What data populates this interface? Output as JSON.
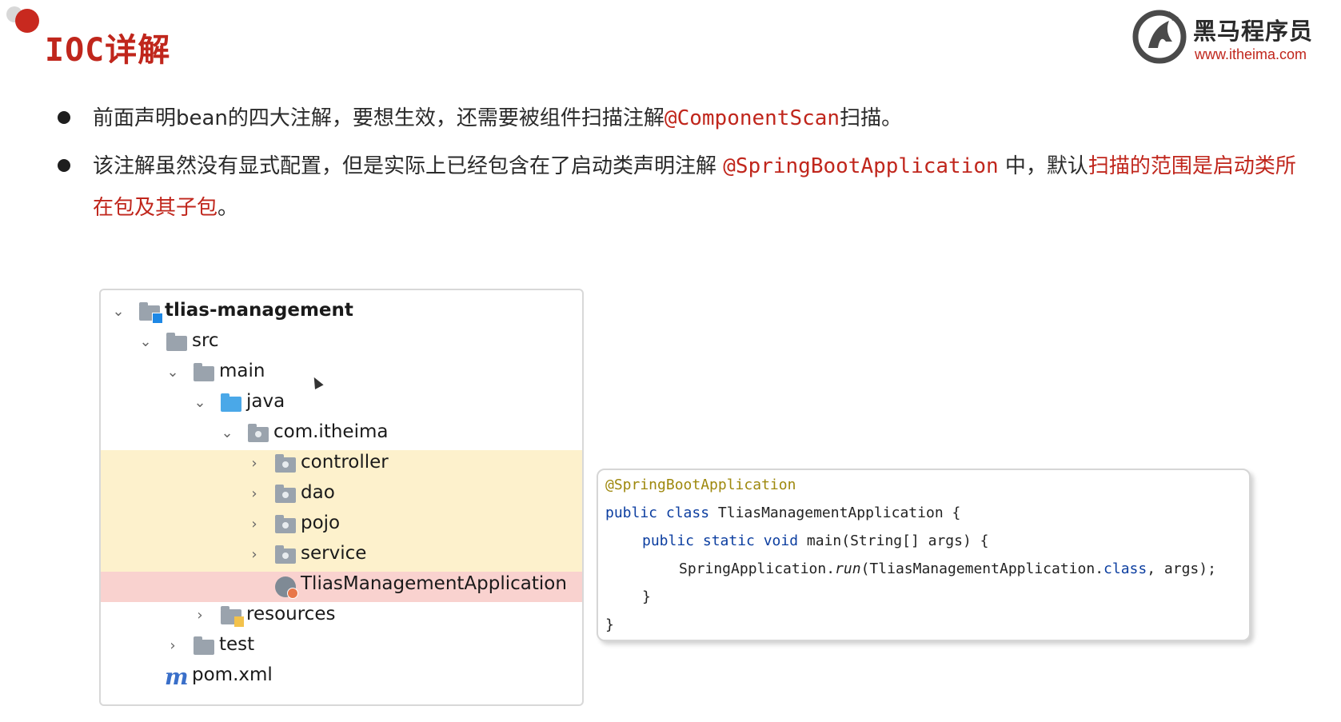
{
  "header": {
    "title": "IOC详解",
    "logo_name": "黑马程序员",
    "logo_url": "www.itheima.com"
  },
  "bullets": [
    {
      "parts": [
        "前面声明bean的四大注解，要想生效，还需要被组件扫描注解",
        "@ComponentScan",
        "扫描。"
      ]
    },
    {
      "parts": [
        "该注解虽然没有显式配置，但是实际上已经包含在了启动类声明注解 ",
        "@SpringBootApplication",
        " 中，默认",
        "扫描的范围是启动类所在包及其子包",
        "。"
      ]
    }
  ],
  "project_tree": {
    "items": [
      {
        "label": "tlias-management",
        "expanded": true
      },
      {
        "label": "src",
        "expanded": true
      },
      {
        "label": "main",
        "expanded": true
      },
      {
        "label": "java",
        "expanded": true
      },
      {
        "label": "com.itheima",
        "expanded": true
      },
      {
        "label": "controller",
        "expanded": false
      },
      {
        "label": "dao",
        "expanded": false
      },
      {
        "label": "pojo",
        "expanded": false
      },
      {
        "label": "service",
        "expanded": false
      },
      {
        "label": "TliasManagementApplication"
      },
      {
        "label": "resources",
        "expanded": false
      },
      {
        "label": "test",
        "expanded": false
      },
      {
        "label": "pom.xml"
      }
    ]
  },
  "code": {
    "annotation": "@SpringBootApplication",
    "l2_kw": "public class ",
    "l2_rest": "TliasManagementApplication {",
    "l3_kw": "public static void ",
    "l3_rest": "main(String[] args) {",
    "l4_a": "SpringApplication.",
    "l4_run": "run",
    "l4_b": "(TliasManagementApplication.",
    "l4_kw": "class",
    "l4_c": ", args);",
    "l5": "}",
    "l6": "}"
  },
  "colors": {
    "accent_red": "#c0261c",
    "package_highlight": "#fdf1cc",
    "app_highlight": "#f9d2cf",
    "annotation": "#9e880d",
    "keyword": "#0c3ea0"
  }
}
